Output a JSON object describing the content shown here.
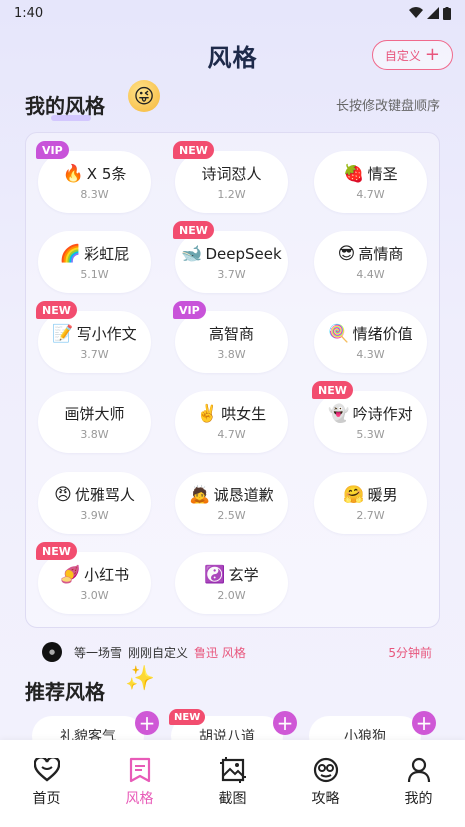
{
  "status": {
    "time": "1:40"
  },
  "header": {
    "title": "风格",
    "custom_label": "自定义"
  },
  "my_styles": {
    "title": "我的风格",
    "hint": "长按修改键盘顺序",
    "items": [
      {
        "emoji": "🔥",
        "label": "X 5条",
        "count": "8.3W",
        "badge": "VIP"
      },
      {
        "emoji": "",
        "label": "诗词怼人",
        "count": "1.2W",
        "badge": "NEW"
      },
      {
        "emoji": "🍓",
        "label": "情圣",
        "count": "4.7W",
        "badge": ""
      },
      {
        "emoji": "🌈",
        "label": "彩虹屁",
        "count": "5.1W",
        "badge": ""
      },
      {
        "emoji": "🐋",
        "label": "DeepSeek",
        "count": "3.7W",
        "badge": "NEW"
      },
      {
        "emoji": "😎",
        "label": "高情商",
        "count": "4.4W",
        "badge": ""
      },
      {
        "emoji": "📝",
        "label": "写小作文",
        "count": "3.7W",
        "badge": "NEW"
      },
      {
        "emoji": "",
        "label": "高智商",
        "count": "3.8W",
        "badge": "VIP"
      },
      {
        "emoji": "🍭",
        "label": "情绪价值",
        "count": "4.3W",
        "badge": ""
      },
      {
        "emoji": "",
        "label": "画饼大师",
        "count": "3.8W",
        "badge": ""
      },
      {
        "emoji": "✌️",
        "label": "哄女生",
        "count": "4.7W",
        "badge": ""
      },
      {
        "emoji": "👻",
        "label": "吟诗作对",
        "count": "5.3W",
        "badge": "NEW"
      },
      {
        "emoji": "😠",
        "label": "优雅骂人",
        "count": "3.9W",
        "badge": ""
      },
      {
        "emoji": "🙇",
        "label": "诚恳道歉",
        "count": "2.5W",
        "badge": ""
      },
      {
        "emoji": "🤗",
        "label": "暖男",
        "count": "2.7W",
        "badge": ""
      },
      {
        "emoji": "🍠",
        "label": "小红书",
        "count": "3.0W",
        "badge": "NEW"
      },
      {
        "emoji": "☯️",
        "label": "玄学",
        "count": "2.0W",
        "badge": ""
      }
    ]
  },
  "activity": {
    "user": "等一场雪",
    "action": "刚刚自定义",
    "style": "鲁迅 风格",
    "time": "5分钟前"
  },
  "recommended": {
    "title": "推荐风格",
    "items": [
      {
        "label": "礼貌客气",
        "badge": ""
      },
      {
        "label": "胡说八道",
        "badge": "NEW"
      },
      {
        "label": "小狼狗",
        "badge": ""
      }
    ]
  },
  "bottom_nav": [
    {
      "label": "首页",
      "icon": "heart-icon"
    },
    {
      "label": "风格",
      "icon": "bookmark-icon"
    },
    {
      "label": "截图",
      "icon": "screenshot-icon"
    },
    {
      "label": "攻略",
      "icon": "guide-icon"
    },
    {
      "label": "我的",
      "icon": "person-icon"
    }
  ],
  "colors": {
    "accent": "#e8557c",
    "vip": "#c853d9",
    "new": "#f24d6f",
    "nav_active": "#e85bb8"
  }
}
